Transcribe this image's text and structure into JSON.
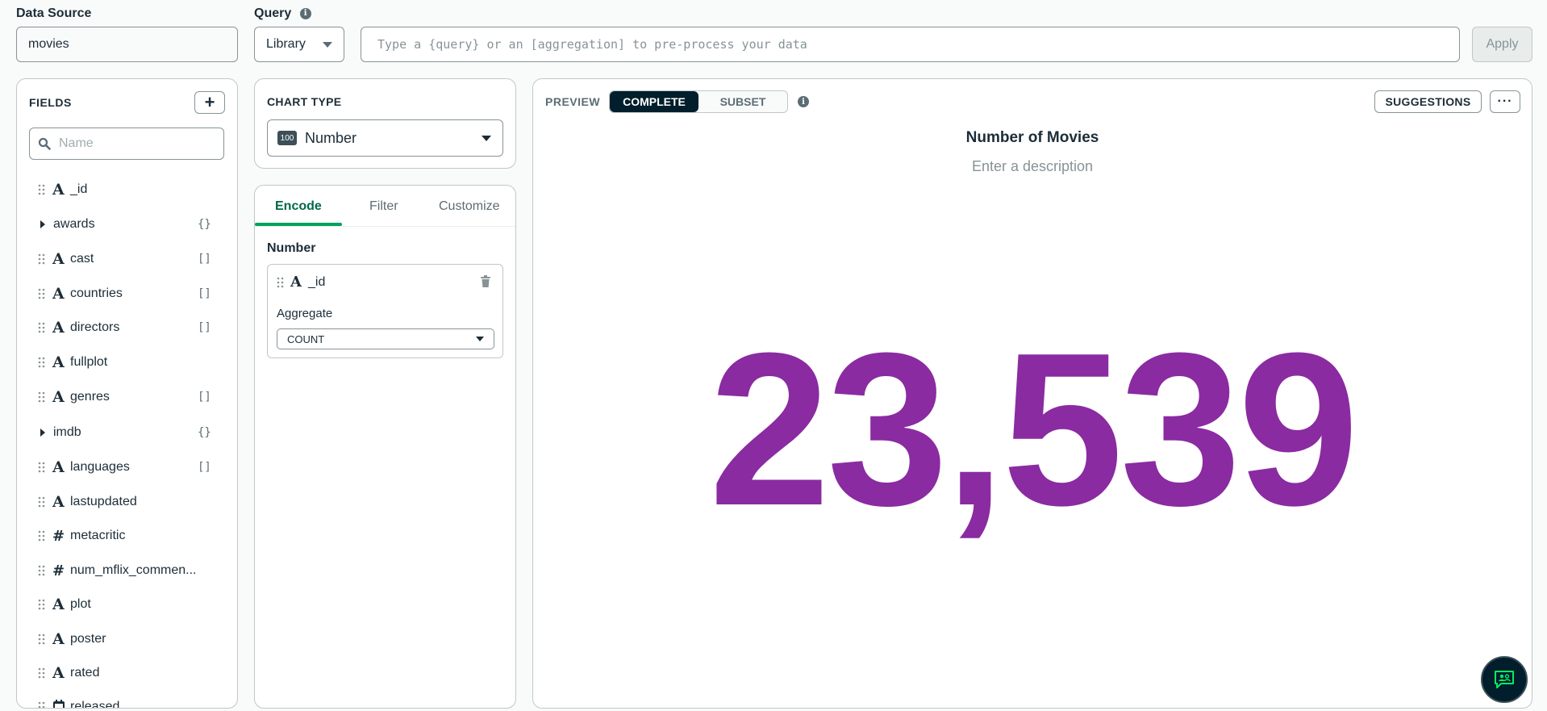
{
  "top": {
    "data_source_label": "Data Source",
    "data_source_value": "movies",
    "query_label": "Query",
    "query_info_icon": "i",
    "library_label": "Library",
    "query_placeholder": "Type a {query} or an [aggregation] to pre-process your data",
    "apply_label": "Apply"
  },
  "fields": {
    "title": "FIELDS",
    "add_icon": "+",
    "search_placeholder": "Name",
    "items": [
      {
        "name": "_id",
        "type": "A",
        "badge": ""
      },
      {
        "name": "awards",
        "type": "nested",
        "badge": "{}"
      },
      {
        "name": "cast",
        "type": "A",
        "badge": "[]"
      },
      {
        "name": "countries",
        "type": "A",
        "badge": "[]"
      },
      {
        "name": "directors",
        "type": "A",
        "badge": "[]"
      },
      {
        "name": "fullplot",
        "type": "A",
        "badge": ""
      },
      {
        "name": "genres",
        "type": "A",
        "badge": "[]"
      },
      {
        "name": "imdb",
        "type": "nested",
        "badge": "{}"
      },
      {
        "name": "languages",
        "type": "A",
        "badge": "[]"
      },
      {
        "name": "lastupdated",
        "type": "A",
        "badge": ""
      },
      {
        "name": "metacritic",
        "type": "#",
        "badge": ""
      },
      {
        "name": "num_mflix_commen...",
        "type": "#",
        "badge": ""
      },
      {
        "name": "plot",
        "type": "A",
        "badge": ""
      },
      {
        "name": "poster",
        "type": "A",
        "badge": ""
      },
      {
        "name": "rated",
        "type": "A",
        "badge": ""
      },
      {
        "name": "released",
        "type": "date",
        "badge": ""
      }
    ]
  },
  "chart_type": {
    "title": "CHART TYPE",
    "icon_text": "100",
    "selected": "Number"
  },
  "encode": {
    "tabs": [
      "Encode",
      "Filter",
      "Customize"
    ],
    "section_title": "Number",
    "field_type": "A",
    "field_name": "_id",
    "aggregate_label": "Aggregate",
    "aggregate_value": "COUNT"
  },
  "preview": {
    "label": "PREVIEW",
    "complete_label": "COMPLETE",
    "subset_label": "SUBSET",
    "info_icon": "i",
    "suggestions_label": "SUGGESTIONS",
    "more_label": "···",
    "chart_title": "Number of Movies",
    "chart_description": "Enter a description",
    "value": "23,539",
    "value_color": "#8a2ba1"
  },
  "colors": {
    "accent_green": "#00a35c",
    "dark": "#001e2b"
  }
}
